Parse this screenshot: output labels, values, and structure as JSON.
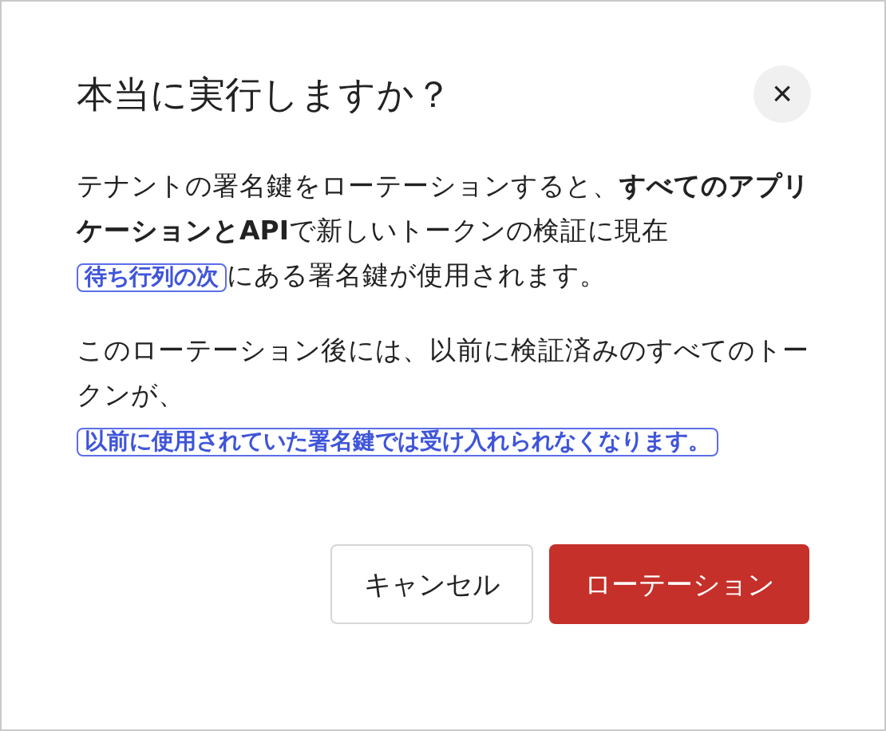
{
  "dialog": {
    "title": "本当に実行しますか？",
    "close_icon": "×",
    "paragraphs": [
      [
        {
          "kind": "plain",
          "text": "テナントの署名鍵をローテーションすると、**すべてのアプリケーションとAPI**で新しいトークンの検証に現在"
        },
        {
          "kind": "tag",
          "text": "待ち行列の次"
        },
        {
          "kind": "plain",
          "text": "にある署名鍵が使用されます。"
        }
      ],
      [
        {
          "kind": "plain",
          "text": "このローテーション後には、以前に検証済みのすべてのトークンが、"
        },
        {
          "kind": "break"
        },
        {
          "kind": "tag",
          "text": "以前に使用されていた署名鍵では受け入れられなくなります。"
        }
      ]
    ],
    "buttons": [
      {
        "kind": "secondary",
        "label": "キャンセル"
      },
      {
        "kind": "danger",
        "label": "ローテーション"
      }
    ]
  }
}
